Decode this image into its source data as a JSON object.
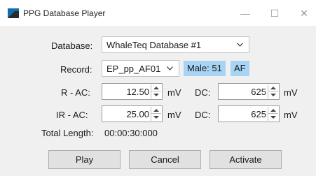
{
  "window": {
    "title": "PPG Database Player",
    "minimize": "—",
    "maximize": "☐",
    "close": "✕"
  },
  "form": {
    "database_label": "Database:",
    "database_value": "WhaleTeq Database #1",
    "record_label": "Record:",
    "record_value": "EP_pp_AF01",
    "badge_gender_age": "Male: 51",
    "badge_rhythm": "AF",
    "r_ac_label": "R - AC:",
    "r_ac_value": "12.50",
    "r_ac_unit": "mV",
    "r_dc_label": "DC:",
    "r_dc_value": "625",
    "r_dc_unit": "mV",
    "ir_ac_label": "IR - AC:",
    "ir_ac_value": "25.00",
    "ir_ac_unit": "mV",
    "ir_dc_label": "DC:",
    "ir_dc_value": "625",
    "ir_dc_unit": "mV",
    "total_length_label": "Total Length:",
    "total_length_value": "00:00:30:000"
  },
  "buttons": {
    "play": "Play",
    "cancel": "Cancel",
    "activate": "Activate"
  },
  "colors": {
    "badge": "#a7d3f5",
    "panel": "#f0f0f0"
  }
}
